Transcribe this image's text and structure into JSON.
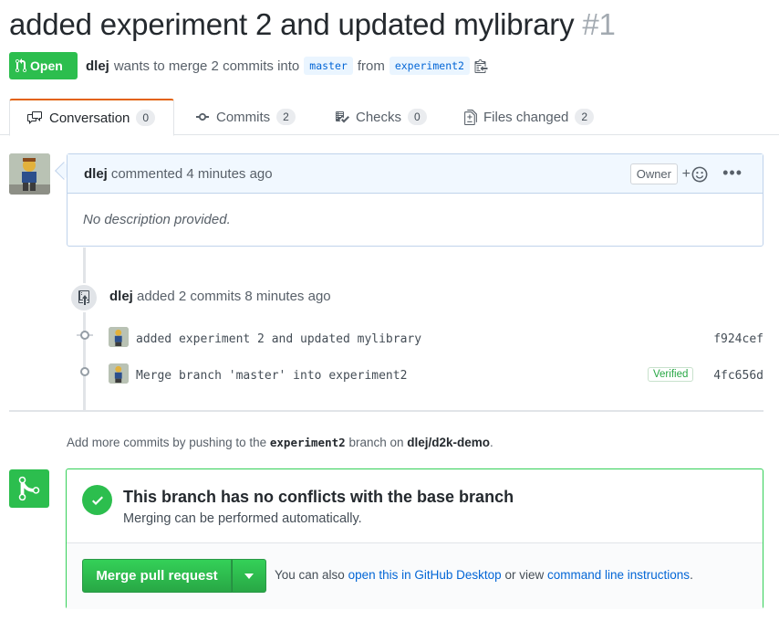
{
  "pr": {
    "title": "added experiment 2 and updated mylibrary",
    "number": "#1",
    "state": "Open",
    "author": "dlej",
    "meta_mid": "wants to merge 2 commits into",
    "base_branch": "master",
    "meta_from": "from",
    "head_branch": "experiment2"
  },
  "tabs": [
    {
      "label": "Conversation",
      "count": "0",
      "icon": "comment-discussion-icon"
    },
    {
      "label": "Commits",
      "count": "2",
      "icon": "git-commit-icon"
    },
    {
      "label": "Checks",
      "count": "0",
      "icon": "checklist-icon"
    },
    {
      "label": "Files changed",
      "count": "2",
      "icon": "file-diff-icon"
    }
  ],
  "comment": {
    "author": "dlej",
    "action": "commented 4 minutes ago",
    "role": "Owner",
    "body": "No description provided."
  },
  "event": {
    "actor": "dlej",
    "text": "added 2 commits 8 minutes ago"
  },
  "commits": [
    {
      "message": "added experiment 2 and updated mylibrary",
      "sha": "f924cef",
      "verified": ""
    },
    {
      "message": "Merge branch 'master' into experiment2",
      "sha": "4fc656d",
      "verified": "Verified"
    }
  ],
  "hint": {
    "prefix": "Add more commits by pushing to the",
    "branch": "experiment2",
    "mid": "branch on",
    "repo": "dlej/d2k-demo",
    "suffix": "."
  },
  "merge": {
    "heading": "This branch has no conflicts with the base branch",
    "sub": "Merging can be performed automatically.",
    "button": "Merge pull request",
    "note_prefix": "You can also",
    "link_desktop": "open this in GitHub Desktop",
    "note_mid": "or view",
    "link_cli": "command line instructions",
    "note_suffix": "."
  },
  "colors": {
    "open_green": "#2cbe4e",
    "link_blue": "#0366d6",
    "tab_accent": "#e36209"
  }
}
